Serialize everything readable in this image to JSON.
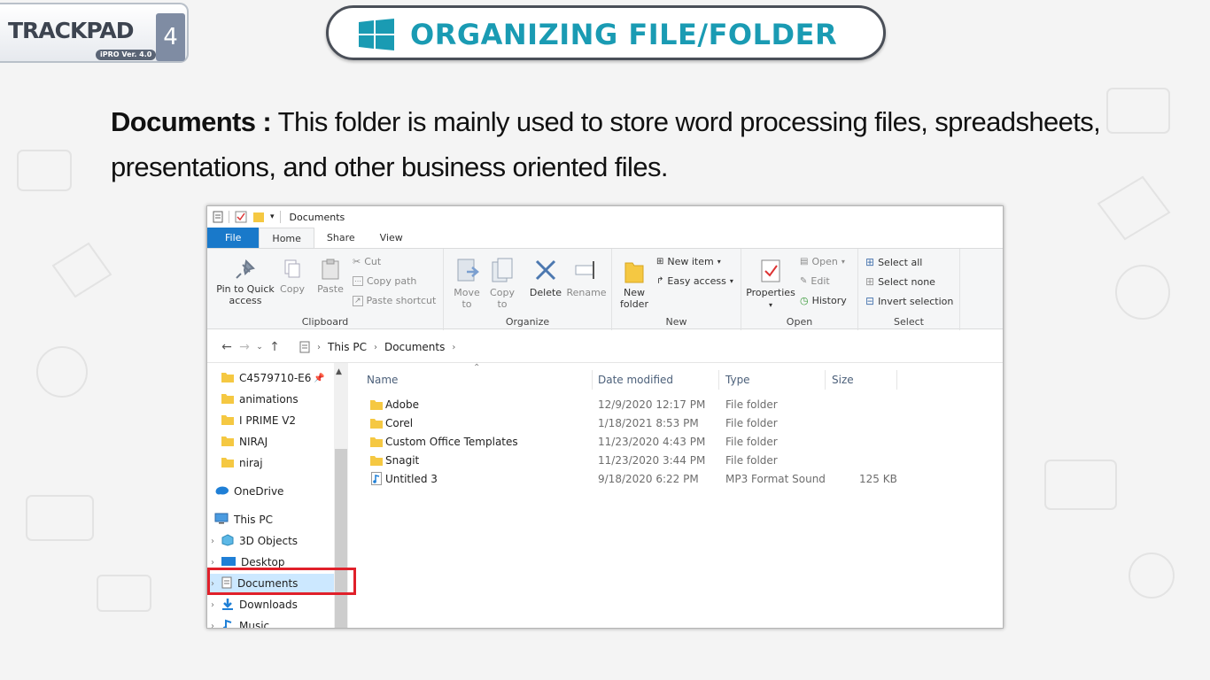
{
  "logo": {
    "word": "TRACKPAD",
    "number": "4",
    "version": "iPRO Ver. 4.0"
  },
  "title": "ORGANIZING FILE/FOLDER",
  "description": {
    "term": "Documents :",
    "text": " This folder is mainly used to store word processing files, spreadsheets, presentations, and other business oriented files."
  },
  "explorer": {
    "window_title": "Documents",
    "tabs": [
      "File",
      "Home",
      "Share",
      "View"
    ],
    "ribbon": {
      "clipboard": {
        "label": "Clipboard",
        "pin": "Pin to Quick access",
        "copy": "Copy",
        "paste": "Paste",
        "cut": "Cut",
        "copy_path": "Copy path",
        "paste_shortcut": "Paste shortcut"
      },
      "organize": {
        "label": "Organize",
        "move_to": "Move to",
        "copy_to": "Copy to",
        "delete": "Delete",
        "rename": "Rename"
      },
      "new": {
        "label": "New",
        "new_folder": "New folder",
        "new_item": "New item",
        "easy_access": "Easy access"
      },
      "open": {
        "label": "Open",
        "properties": "Properties",
        "open": "Open",
        "edit": "Edit",
        "history": "History"
      },
      "select": {
        "label": "Select",
        "select_all": "Select all",
        "select_none": "Select none",
        "invert": "Invert selection"
      }
    },
    "address": {
      "crumbs": [
        "This PC",
        "Documents"
      ]
    },
    "nav": [
      {
        "label": "C4579710-E6",
        "type": "folder"
      },
      {
        "label": "animations",
        "type": "folder"
      },
      {
        "label": "I PRIME V2",
        "type": "folder"
      },
      {
        "label": "NIRAJ",
        "type": "folder"
      },
      {
        "label": "niraj",
        "type": "folder"
      },
      {
        "label": "OneDrive",
        "type": "cloud"
      },
      {
        "label": "This PC",
        "type": "pc"
      },
      {
        "label": "3D Objects",
        "type": "3d"
      },
      {
        "label": "Desktop",
        "type": "desktop"
      },
      {
        "label": "Documents",
        "type": "doc"
      },
      {
        "label": "Downloads",
        "type": "download"
      },
      {
        "label": "Music",
        "type": "music"
      }
    ],
    "columns": [
      "Name",
      "Date modified",
      "Type",
      "Size"
    ],
    "files": [
      {
        "name": "Adobe",
        "date": "12/9/2020 12:17 PM",
        "type": "File folder",
        "size": "",
        "icon": "folder"
      },
      {
        "name": "Corel",
        "date": "1/18/2021 8:53 PM",
        "type": "File folder",
        "size": "",
        "icon": "folder"
      },
      {
        "name": "Custom Office Templates",
        "date": "11/23/2020 4:43 PM",
        "type": "File folder",
        "size": "",
        "icon": "folder"
      },
      {
        "name": "Snagit",
        "date": "11/23/2020 3:44 PM",
        "type": "File folder",
        "size": "",
        "icon": "folder"
      },
      {
        "name": "Untitled 3",
        "date": "9/18/2020 6:22 PM",
        "type": "MP3 Format Sound",
        "size": "125 KB",
        "icon": "audio"
      }
    ]
  },
  "colors": {
    "title": "#1a9bb3",
    "file_tab": "#1979ca",
    "folder": "#f5c842",
    "highlight": "#e0202a"
  }
}
